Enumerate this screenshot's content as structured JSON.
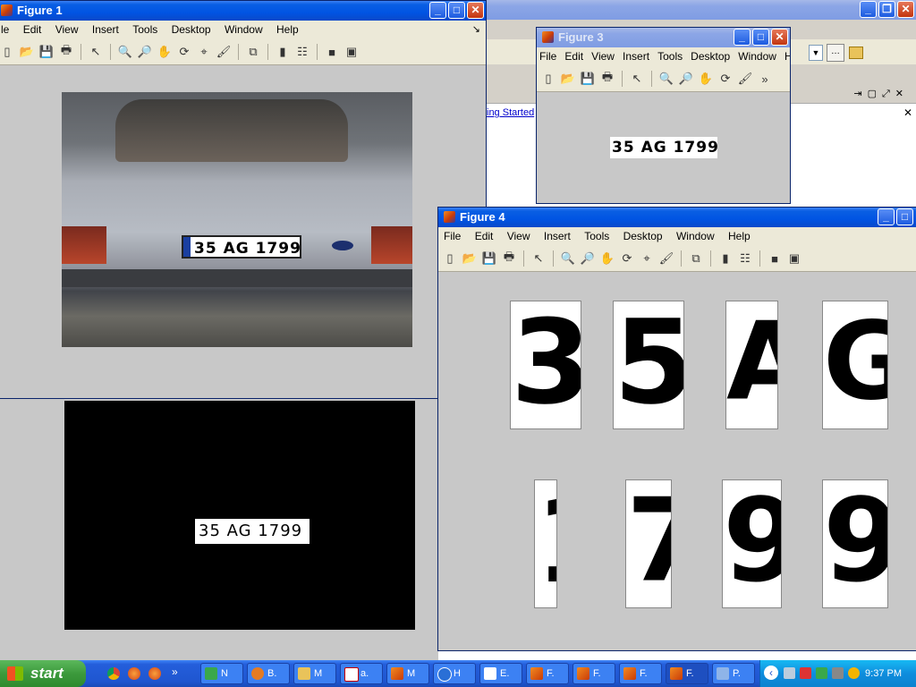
{
  "figure1": {
    "title": "Figure 1",
    "menu": [
      "le",
      "Edit",
      "View",
      "Insert",
      "Tools",
      "Desktop",
      "Window",
      "Help"
    ]
  },
  "matlab_bg": {
    "link": "ing Started"
  },
  "figure3": {
    "title": "Figure 3",
    "menu": [
      "File",
      "Edit",
      "View",
      "Insert",
      "Tools",
      "Desktop",
      "Window",
      "Help"
    ],
    "plate_text": "35 AG 1799"
  },
  "figure4": {
    "title": "Figure 4",
    "menu": [
      "File",
      "Edit",
      "View",
      "Insert",
      "Tools",
      "Desktop",
      "Window",
      "Help"
    ],
    "characters": [
      "3",
      "5",
      "A",
      "G",
      "1",
      "7",
      "9",
      "9"
    ]
  },
  "photo": {
    "plate_text": "35 AG 1799"
  },
  "binary": {
    "plate_text": "35 AG 1799"
  },
  "taskbar": {
    "start_label": "start",
    "items": [
      "N",
      "B.",
      "M",
      "a.",
      "M",
      "H",
      "E.",
      "F.",
      "F.",
      "F.",
      "F.",
      "P."
    ],
    "clock": "9:37 PM"
  }
}
